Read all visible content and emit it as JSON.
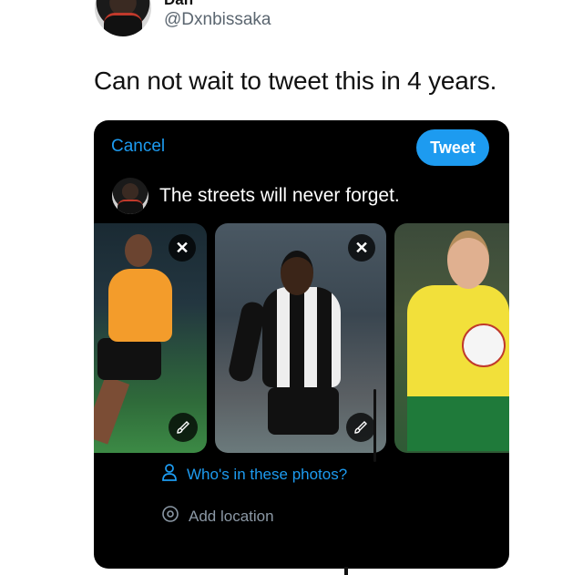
{
  "author": {
    "display_name_partial": "Dan",
    "handle": "@Dxnbissaka"
  },
  "tweet": {
    "text": "Can not wait to tweet this in 4 years."
  },
  "compose": {
    "cancel_label": "Cancel",
    "tweet_label": "Tweet",
    "text": "The streets will never forget.",
    "photos": [
      {
        "remove_icon": "close-icon",
        "edit_icon": "brush-icon"
      },
      {
        "remove_icon": "close-icon",
        "edit_icon": "brush-icon"
      },
      {}
    ],
    "tag_people_label": "Who's in these photos?",
    "add_location_label": "Add location"
  },
  "colors": {
    "accent": "#1d9bf0",
    "background": "#000000",
    "muted_text": "#8b98a5"
  }
}
